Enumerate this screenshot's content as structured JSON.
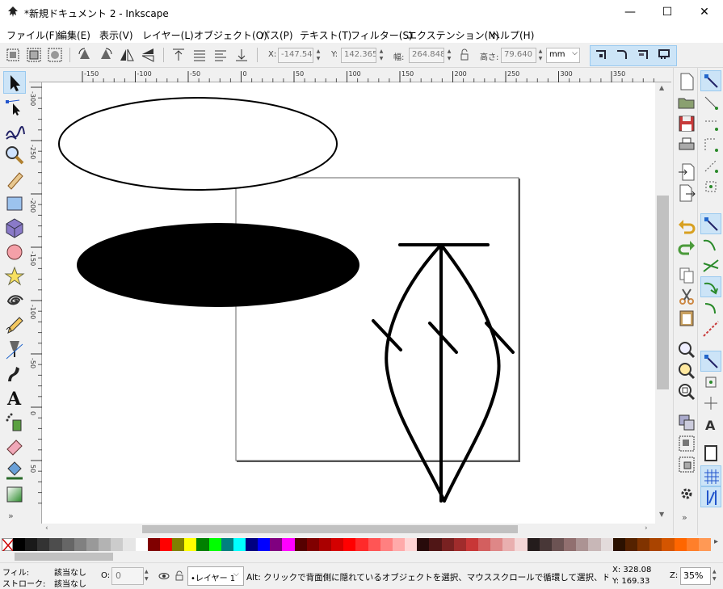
{
  "window": {
    "title": "*新規ドキュメント 2 - Inkscape",
    "minimize": "—",
    "maximize": "☐",
    "close": "✕"
  },
  "menu": [
    "ファイル(F)",
    "編集(E)",
    "表示(V)",
    "レイヤー(L)",
    "オブジェクト(O)",
    "パス(P)",
    "テキスト(T)",
    "フィルター(S)",
    "エクステンション(N)",
    "ヘルプ(H)"
  ],
  "toolbar": {
    "x_label": "X:",
    "x_value": "-147.54:",
    "y_label": "Y:",
    "y_value": "142.365",
    "w_label": "幅:",
    "w_value": "264.848",
    "h_label": "高さ:",
    "h_value": "79.640",
    "unit": "mm"
  },
  "hruler_ticks": [
    "-150",
    "-100",
    "-50",
    "0",
    "50",
    "100",
    "150",
    "200",
    "250",
    "300",
    "350"
  ],
  "vruler_ticks": [
    "-300",
    "-250",
    "-200",
    "-150",
    "-100",
    "-50",
    "0",
    "50"
  ],
  "left_tools": [
    "select-tool-icon",
    "node-tool-icon",
    "tweak-tool-icon",
    "zoom-tool-icon",
    "measure-tool-icon",
    "rectangle-tool-icon",
    "box3d-tool-icon",
    "ellipse-tool-icon",
    "star-tool-icon",
    "spiral-tool-icon",
    "pencil-tool-icon",
    "pen-tool-icon",
    "calligraphy-tool-icon",
    "text-tool-icon",
    "spray-tool-icon",
    "eraser-tool-icon",
    "paint-bucket-tool-icon",
    "gradient-tool-icon"
  ],
  "palette_colors": [
    "#000000",
    "#1a1a1a",
    "#333333",
    "#4d4d4d",
    "#666666",
    "#808080",
    "#999999",
    "#b3b3b3",
    "#cccccc",
    "#e6e6e6",
    "#ffffff",
    "#800000",
    "#ff0000",
    "#808000",
    "#ffff00",
    "#008000",
    "#00ff00",
    "#008080",
    "#00ffff",
    "#000080",
    "#0000ff",
    "#800080",
    "#ff00ff",
    "#550000",
    "#800000",
    "#aa0000",
    "#d40000",
    "#ff0000",
    "#ff2a2a",
    "#ff5555",
    "#ff8080",
    "#ffaaaa",
    "#ffd5d5",
    "#280b0b",
    "#501616",
    "#782121",
    "#a02c2c",
    "#c83737",
    "#d35f5f",
    "#de8787",
    "#e9afaf",
    "#f4d7d7",
    "#241c1c",
    "#483737",
    "#6c5353",
    "#916f6f",
    "#ac9393",
    "#c8b7b7",
    "#e3dbdb",
    "#2b1100",
    "#552200",
    "#803300",
    "#aa4400",
    "#d45500",
    "#ff6600",
    "#ff7f2a",
    "#ff9955"
  ],
  "status": {
    "fill_label": "フィル:",
    "fill_value": "該当なし",
    "stroke_label": "ストローク:",
    "stroke_value": "該当なし",
    "opacity_label": "O:",
    "opacity_value": "0",
    "layer": "•レイヤー 1",
    "message": "Alt: クリックで背面側に隠れているオブジェクトを選択、マウススクロールで循環して選択、ドラッ...",
    "x_coord": "X: 328.08",
    "y_coord": "Y: 169.33",
    "zoom_label": "Z:",
    "zoom_value": "35%"
  }
}
